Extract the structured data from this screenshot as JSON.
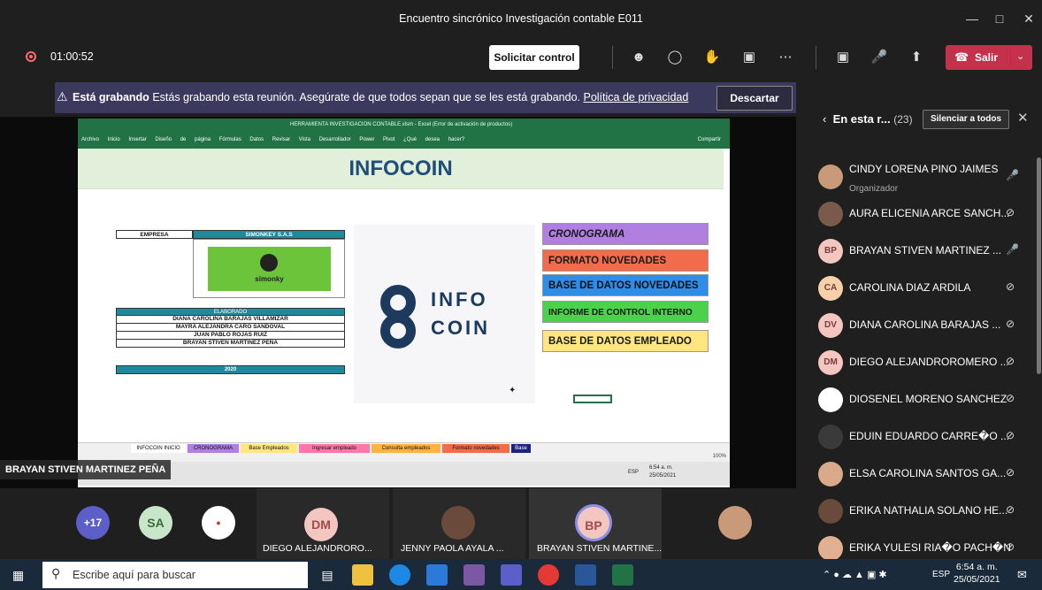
{
  "window": {
    "title": "Encuentro sincrónico Investigación contable E011"
  },
  "toolbar": {
    "timer": "01:00:52",
    "request_control": "Solicitar control",
    "leave": "Salir"
  },
  "banner": {
    "bold": "Está grabando",
    "text": "Estás grabando esta reunión. Asegúrate de que todos sepan que se les está grabando.",
    "link": "Política de privacidad",
    "dismiss": "Descartar"
  },
  "excel": {
    "title": "HERRAMIENTA INVESTIGACION CONTABLE.xlsm - Excel (Error de activación de productos)",
    "menu": "Archivo Inicio Insertar Diseño de página Fórmulas Datos Revisar Vista Desarrollador Power Pivot ¿Qué desea hacer?",
    "share": "Compartir",
    "sheet_title": "INFOCOIN",
    "empresa_label": "EMPRESA",
    "empresa_value": "SIMONKEY S.A.S",
    "simonky": "simonky",
    "elaborado": "ELABORADO",
    "authors": [
      "DIANA CAROLINA BARAJAS VILLAMIZAR",
      "MAYRA ALEJANDRA CARO SANDOVAL",
      "JUAN PABLO ROJAS RUIZ",
      "BRAYAN STIVEN MARTINEZ PEÑA"
    ],
    "year": "2020",
    "logo_line1": "INFO",
    "logo_line2": "COIN",
    "menu_buttons": [
      {
        "label": "CRONOGRAMA",
        "color": "#b07fe0"
      },
      {
        "label": "FORMATO NOVEDADES",
        "color": "#f26b4a"
      },
      {
        "label": "BASE DE DATOS NOVEDADES",
        "color": "#2e8de8"
      },
      {
        "label": "INFORME DE CONTROL INTERNO",
        "color": "#4bd14b"
      },
      {
        "label": "BASE DE DATOS EMPLEADO",
        "color": "#ffe680"
      }
    ],
    "tabs": [
      {
        "label": "INFOCOIN INICIO",
        "color": "#ffffff"
      },
      {
        "label": "CRONOGRAMA",
        "color": "#b07fe0"
      },
      {
        "label": "Base Empleados",
        "color": "#ffe680"
      },
      {
        "label": "Ingresar empleado",
        "color": "#ff77aa"
      },
      {
        "label": "Consulta empleados",
        "color": "#ffb340"
      },
      {
        "label": "Formato novedades",
        "color": "#f26b4a"
      },
      {
        "label": "Base",
        "color": "#1a237e"
      }
    ],
    "zoom": "100%",
    "inner_time": "6:54 a. m.",
    "inner_date": "25/05/2021",
    "inner_lang": "ESP"
  },
  "presenter_label": "BRAYAN STIVEN MARTINEZ PEÑA",
  "strip": {
    "more": "+17",
    "sa": "SA",
    "tiles": [
      {
        "initials": "DM",
        "name": "DIEGO ALEJANDRORO..."
      },
      {
        "initials": "",
        "name": "JENNY PAOLA AYALA ..."
      },
      {
        "initials": "BP",
        "name": "BRAYAN STIVEN MARTINE..."
      }
    ]
  },
  "panel": {
    "title": "En esta r...",
    "count": "(23)",
    "mute_all": "Silenciar a todos",
    "participants": [
      {
        "initials": "",
        "name": "CINDY LORENA PINO JAIMES",
        "role": "Organizador",
        "mic": "on",
        "color": "#c89a7a"
      },
      {
        "initials": "",
        "name": "AURA ELICENIA ARCE SANCH...",
        "role": "",
        "mic": "off",
        "color": "#7a5a4a"
      },
      {
        "initials": "BP",
        "name": "BRAYAN STIVEN MARTINEZ ...",
        "role": "",
        "mic": "on",
        "color": "#f3c6c0"
      },
      {
        "initials": "CA",
        "name": "CAROLINA DIAZ ARDILA",
        "role": "",
        "mic": "off",
        "color": "#f5d0a9"
      },
      {
        "initials": "DV",
        "name": "DIANA CAROLINA BARAJAS ...",
        "role": "",
        "mic": "off",
        "color": "#f3c6c0"
      },
      {
        "initials": "DM",
        "name": "DIEGO ALEJANDROROMERO ...",
        "role": "",
        "mic": "off",
        "color": "#f3c6c0"
      },
      {
        "initials": "",
        "name": "DIOSENEL MORENO SANCHEZ",
        "role": "",
        "mic": "off",
        "color": "#ffffff"
      },
      {
        "initials": "",
        "name": "EDUIN EDUARDO CARRE�O ...",
        "role": "",
        "mic": "off",
        "color": "#3a3a3a"
      },
      {
        "initials": "",
        "name": "ELSA CAROLINA SANTOS GA...",
        "role": "",
        "mic": "off",
        "color": "#d9a98a"
      },
      {
        "initials": "",
        "name": "ERIKA NATHALIA SOLANO HE...",
        "role": "",
        "mic": "off",
        "color": "#6a4a3a"
      },
      {
        "initials": "",
        "name": "ERIKA YULESI RIA�O PACH�N",
        "role": "",
        "mic": "off",
        "color": "#e0b090"
      }
    ]
  },
  "taskbar": {
    "search_placeholder": "Escribe aquí para buscar",
    "lang": "ESP",
    "time": "6:54 a. m.",
    "date": "25/05/2021"
  }
}
